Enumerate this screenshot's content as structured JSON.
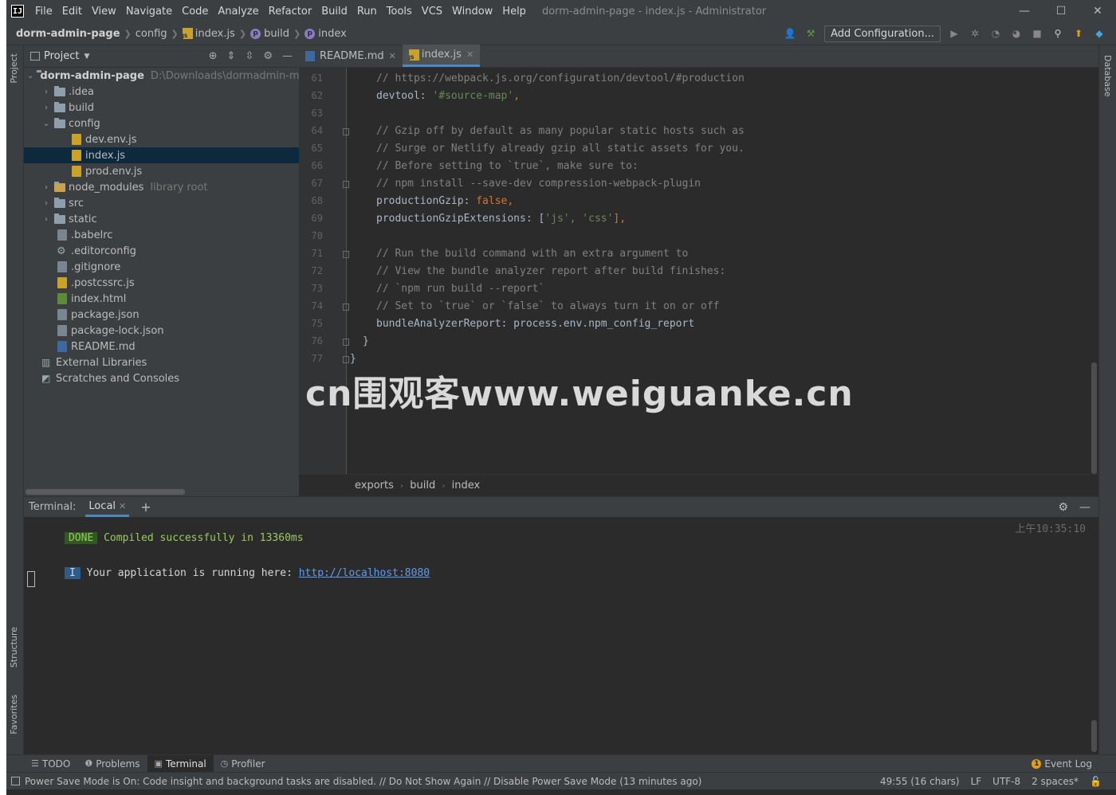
{
  "titlebar": {
    "logo": "IJ",
    "menu": [
      "File",
      "Edit",
      "View",
      "Navigate",
      "Code",
      "Analyze",
      "Refactor",
      "Build",
      "Run",
      "Tools",
      "VCS",
      "Window",
      "Help"
    ],
    "title": "dorm-admin-page - index.js - Administrator",
    "controls": {
      "minimize": "—",
      "maximize": "☐",
      "close": "✕"
    }
  },
  "navbar": {
    "crumbs": [
      "dorm-admin-page",
      "config",
      "index.js",
      "build",
      "index"
    ],
    "add_configuration": "Add Configuration..."
  },
  "left_stripe": {
    "project": "Project",
    "structure": "Structure",
    "favorites": "Favorites"
  },
  "right_stripe": {
    "database": "Database"
  },
  "project": {
    "title": "Project",
    "root": {
      "name": "dorm-admin-page",
      "path": "D:\\Downloads\\dormadmin-mast"
    },
    "items": [
      {
        "name": ".idea"
      },
      {
        "name": "build"
      },
      {
        "name": "config"
      },
      {
        "name": "dev.env.js"
      },
      {
        "name": "index.js"
      },
      {
        "name": "prod.env.js"
      },
      {
        "name": "node_modules",
        "hint": "library root"
      },
      {
        "name": "src"
      },
      {
        "name": "static"
      },
      {
        "name": ".babelrc"
      },
      {
        "name": ".editorconfig"
      },
      {
        "name": ".gitignore"
      },
      {
        "name": ".postcssrc.js"
      },
      {
        "name": "index.html"
      },
      {
        "name": "package.json"
      },
      {
        "name": "package-lock.json"
      },
      {
        "name": "README.md"
      },
      {
        "name": "External Libraries"
      },
      {
        "name": "Scratches and Consoles"
      }
    ]
  },
  "editor": {
    "tabs": [
      {
        "label": "README.md"
      },
      {
        "label": "index.js"
      }
    ],
    "lines": [
      {
        "n": "61",
        "text": "// https://webpack.js.org/configuration/devtool/#production"
      },
      {
        "n": "62",
        "k": "devtool: ",
        "v": "'#source-map'",
        "p": ","
      },
      {
        "n": "63",
        "text": ""
      },
      {
        "n": "64",
        "text": "// Gzip off by default as many popular static hosts such as"
      },
      {
        "n": "65",
        "text": "// Surge or Netlify already gzip all static assets for you."
      },
      {
        "n": "66",
        "text": "// Before setting to `true`, make sure to:"
      },
      {
        "n": "67",
        "text": "// npm install --save-dev compression-webpack-plugin"
      },
      {
        "n": "68",
        "k": "productionGzip: ",
        "v": "false",
        "p": ","
      },
      {
        "n": "69",
        "k": "productionGzipExtensions: [",
        "v": "'js', 'css'",
        "p": "],"
      },
      {
        "n": "70",
        "text": ""
      },
      {
        "n": "71",
        "text": "// Run the build command with an extra argument to"
      },
      {
        "n": "72",
        "text": "// View the bundle analyzer report after build finishes:"
      },
      {
        "n": "73",
        "text": "// `npm run build --report`"
      },
      {
        "n": "74",
        "text": "// Set to `true` or `false` to always turn it on or off"
      },
      {
        "n": "75",
        "k": "bundleAnalyzerReport: process.env.npm_config_report",
        "v": "",
        "p": ""
      },
      {
        "n": "76",
        "text": "}"
      },
      {
        "n": "77",
        "text": "}"
      }
    ],
    "breadcrumb": [
      "exports",
      "build",
      "index"
    ]
  },
  "watermark": "cn围观客www.weiguanke.cn",
  "terminal": {
    "label": "Terminal:",
    "tab": "Local",
    "done_badge": "DONE",
    "compiled": "Compiled successfully in 13360ms",
    "timestamp": "上午10:35:10",
    "info_badge": "I",
    "running": "Your application is running here: ",
    "url": "http://localhost:8080"
  },
  "toolwindows": {
    "todo": "TODO",
    "problems": "Problems",
    "terminal": "Terminal",
    "profiler": "Profiler",
    "event_log": "Event Log"
  },
  "status": {
    "message": "Power Save Mode is On: Code insight and background tasks are disabled. // Do Not Show Again // Disable Power Save Mode (13 minutes ago)",
    "position": "49:55 (16 chars)",
    "line_sep": "LF",
    "encoding": "UTF-8",
    "indent": "2 spaces*"
  }
}
